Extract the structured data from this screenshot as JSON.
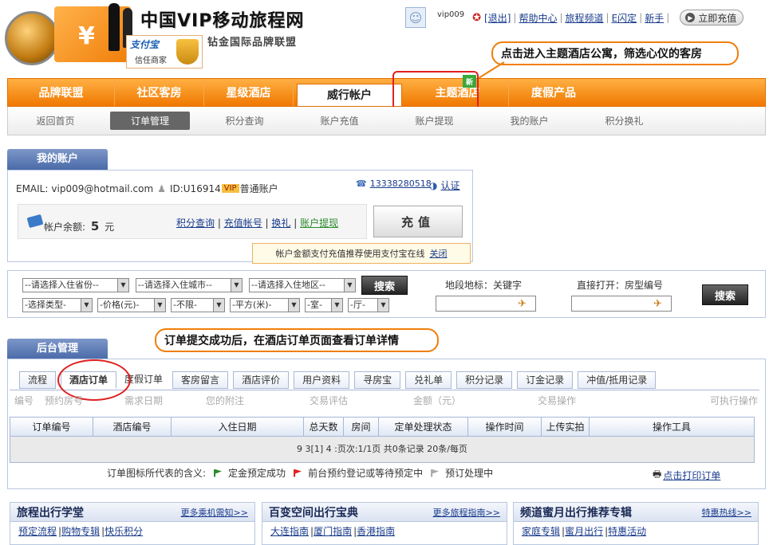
{
  "header": {
    "logo_brand": "中国VIP移动旅程网",
    "logo_slogan": "钻金国际品牌联盟",
    "alipay_name": "支付宝",
    "alipay_sub": "信任商家",
    "username": "vip009",
    "logout": "[退出]",
    "links": [
      "帮助中心",
      "旅程频道",
      "E闪定",
      "新手"
    ],
    "recharge_button": "立即充值"
  },
  "callouts": {
    "top": "点击进入主题酒店公寓，筛选心仪的客房",
    "middle": "订单提交成功后，在酒店订单页面查看订单详情"
  },
  "main_nav": [
    "品牌联盟",
    "社区客房",
    "星级酒店",
    "威行帐户",
    "主题酒店",
    "度假产品"
  ],
  "new_badge": "新",
  "sub_nav": [
    "返回首页",
    "订单管理",
    "积分查询",
    "账户充值",
    "账户提现",
    "我的账户",
    "积分换礼"
  ],
  "account": {
    "title": "我的账户",
    "email_label": "EMAIL:",
    "email": "vip009@hotmail.com",
    "id_label": "ID:U16914",
    "vip": "VIP",
    "account_type": "普通账户",
    "phone": "13338280518",
    "auth": "认证",
    "balance_label": "帐户余额:",
    "balance_value": "5",
    "balance_unit": "元",
    "links": [
      "积分查询",
      "充值帐号",
      "换礼",
      "账户提现"
    ],
    "recharge": "充值",
    "tip": "帐户金额支付充值推荐使用支付宝在线",
    "tip_close": "关闭"
  },
  "search": {
    "selects_row1": [
      "--请选择入住省份--",
      "--请选择入住城市--",
      "--请选择入住地区--"
    ],
    "selects_row2": [
      "-选择类型-",
      "-价格(元)-",
      "-不限-",
      "-平方(米)-",
      "-室-",
      "-厅-"
    ],
    "search_button": "搜索",
    "landmark_label": "地段地标：关键字",
    "direct_label": "直接打开：房型编号",
    "search_button2": "搜索"
  },
  "backend": {
    "title": "后台管理",
    "tabs": [
      "流程",
      "酒店订单",
      "度假订单",
      "客房留言",
      "酒店评价",
      "用户资料",
      "寻房宝",
      "兑礼单",
      "积分记录",
      "订金记录",
      "冲值/抵用记录"
    ],
    "ghost_headers": [
      "编号",
      "预约房号",
      "需求日期",
      "您的附注",
      "交易评估",
      "金额（元）",
      "交易操作",
      "可执行操作"
    ],
    "columns": [
      "订单编号",
      "酒店编号",
      "入住日期",
      "总天数",
      "房间",
      "定单处理状态",
      "操作时间",
      "上传实拍",
      "操作工具"
    ],
    "pager": "9 3[1] 4 :页次:1/1页 共0条记录 20条/每页",
    "pager_link": "1",
    "legend_label": "订单图标所代表的含义:",
    "legend": [
      "定金预定成功",
      "前台预约登记或等待预定中",
      "预订处理中"
    ],
    "print_link": "点击打印订单"
  },
  "bottom": [
    {
      "title": "旅程出行学堂",
      "more": "更多乘机需知>>",
      "links": [
        "预定流程",
        "购物专辑",
        "快乐积分"
      ]
    },
    {
      "title": "百变空间出行宝典",
      "more": "更多旅程指南>>",
      "links": [
        "大连指南",
        "厦门指南",
        "香港指南"
      ]
    },
    {
      "title": "频道蜜月出行推荐专辑",
      "more": "特惠热线>>",
      "links": [
        "家庭专辑",
        "蜜月出行",
        "特惠活动"
      ]
    }
  ],
  "colors": {
    "nav_orange": "#f07800",
    "panel_blue": "#4a6aa8",
    "callout_border": "#f07e0a",
    "highlight_red": "#e02020"
  }
}
